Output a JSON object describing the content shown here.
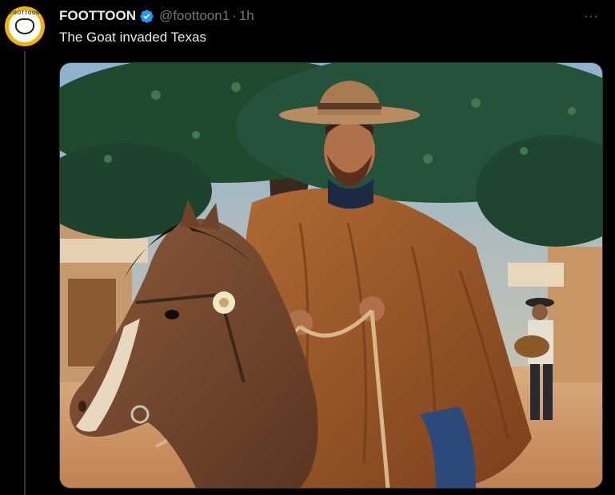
{
  "tweet": {
    "author": {
      "display_name": "FOOTTOON",
      "handle": "@foottoon1",
      "verified": true,
      "avatar_text": "FOOTTOON"
    },
    "separator": "·",
    "time": "1h",
    "text": "The Goat invaded Texas",
    "more_label": "···",
    "media": {
      "description_icon": "photo",
      "colors": {
        "sky": "#6a8fb5",
        "foliage": "#1f4a2e",
        "ground": "#d8a877",
        "poncho": "#9a5a2a",
        "horse": "#7a4a2c",
        "hat": "#b78a63"
      }
    }
  },
  "colors": {
    "background": "#000000",
    "text_primary": "#e7e9ea",
    "text_secondary": "#71767b",
    "verified_blue": "#1d9bf0",
    "avatar_yellow": "#f3b400"
  }
}
